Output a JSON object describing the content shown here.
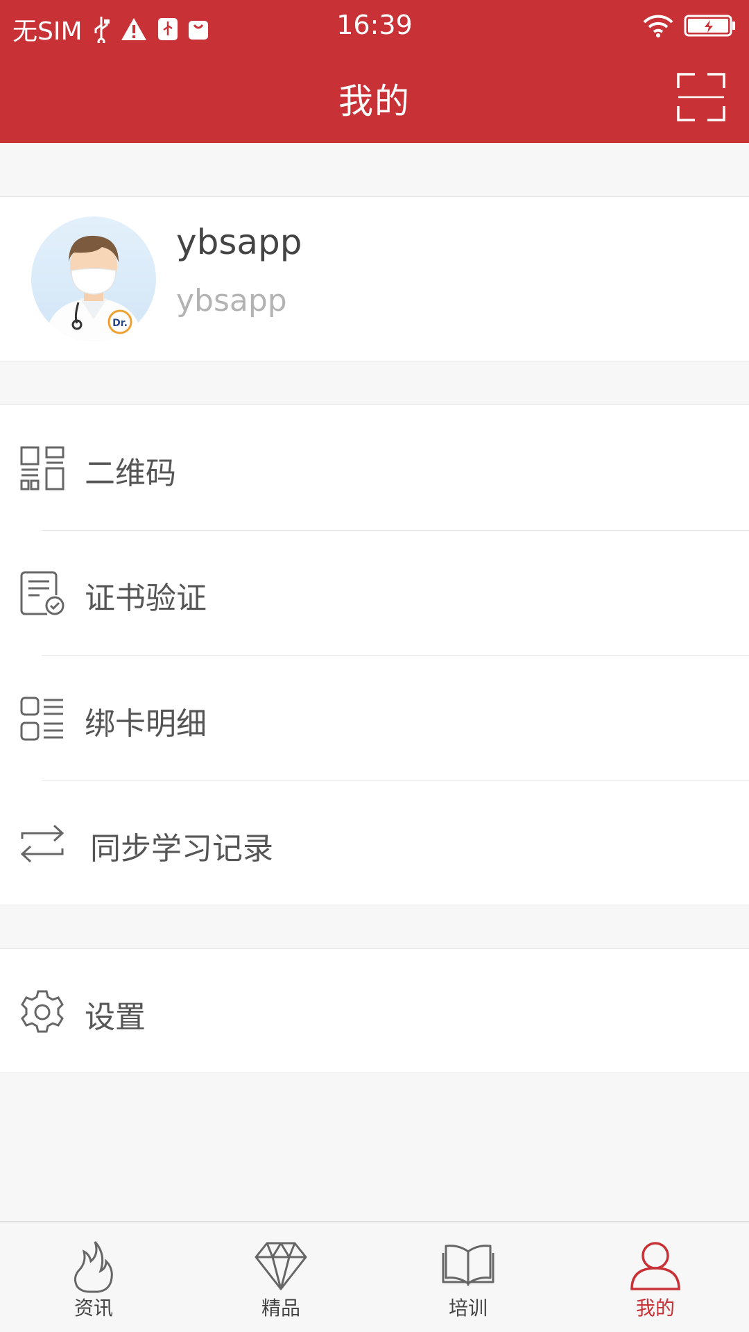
{
  "status_bar": {
    "carrier": "无SIM",
    "time": "16:39"
  },
  "header": {
    "title": "我的"
  },
  "profile": {
    "name": "ybsapp",
    "account": "ybsapp",
    "avatar_badge": "Dr."
  },
  "menu": {
    "items": [
      {
        "label": "二维码",
        "icon": "qr-code-icon"
      },
      {
        "label": "证书验证",
        "icon": "certificate-check-icon"
      },
      {
        "label": "绑卡明细",
        "icon": "list-details-icon"
      },
      {
        "label": "同步学习记录",
        "icon": "sync-icon"
      }
    ],
    "settings": {
      "label": "设置",
      "icon": "gear-icon"
    }
  },
  "tabbar": {
    "active_color": "#c83236",
    "tabs": [
      {
        "label": "资讯",
        "icon": "flame-icon"
      },
      {
        "label": "精品",
        "icon": "diamond-icon"
      },
      {
        "label": "培训",
        "icon": "book-icon"
      },
      {
        "label": "我的",
        "icon": "user-icon",
        "active": true
      }
    ]
  },
  "colors": {
    "brand_red": "#c83236",
    "background": "#f7f7f7"
  }
}
